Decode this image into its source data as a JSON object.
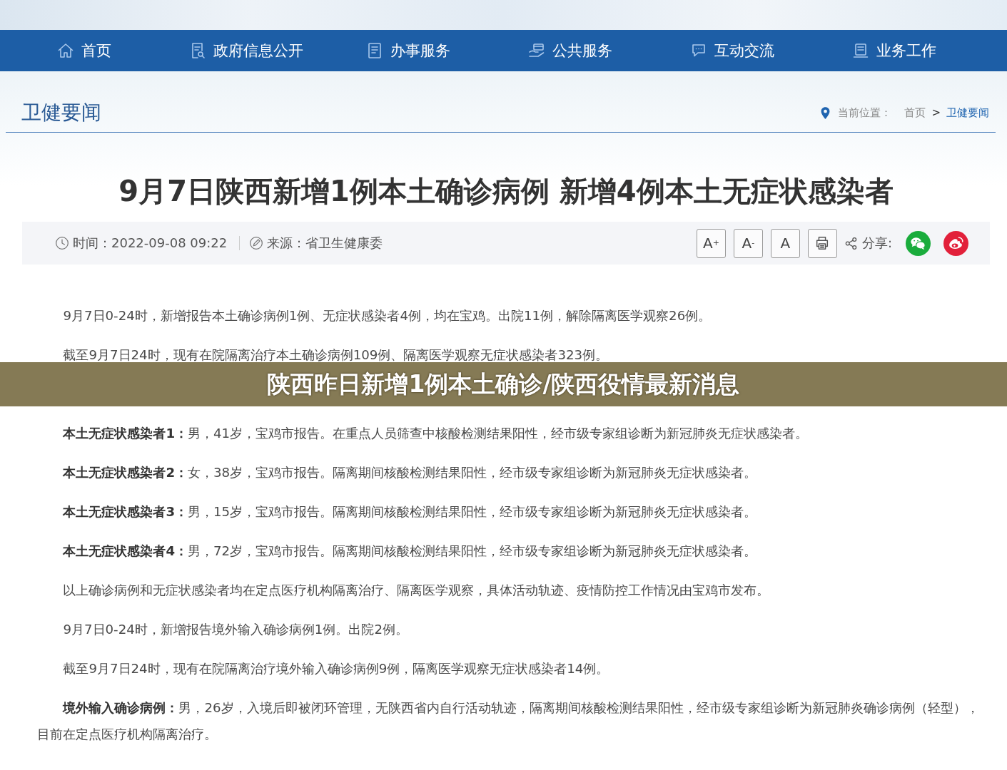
{
  "nav": [
    {
      "label": "首页",
      "selected": false
    },
    {
      "label": "政府信息公开",
      "selected": false
    },
    {
      "label": "办事服务",
      "selected": false
    },
    {
      "label": "公共服务",
      "selected": false
    },
    {
      "label": "互动交流",
      "selected": false
    },
    {
      "label": "业务工作",
      "selected": false
    }
  ],
  "section": {
    "title": "卫健要闻"
  },
  "breadcrumb": {
    "label": "当前位置：",
    "separator": ">",
    "items": [
      {
        "label": "首页",
        "current": false
      },
      {
        "label": "卫健要闻",
        "current": true
      }
    ]
  },
  "article": {
    "title": "9月7日陕西新增1例本土确诊病例 新增4例本土无症状感染者",
    "time": "时间：2022-09-08 09:22",
    "source": "来源：省卫生健康委",
    "font_buttons": [
      "A$^{+}$",
      "A$^{-}$",
      "A"
    ],
    "share_label": "分享:",
    "paragraphs": [
      "9月7日0-24时，新增报告本土确诊病例1例、无症状感染者4例，均在宝鸡。出院11例，解除隔离医学观察26例。",
      "截至9月7日24时，现有在院隔离治疗本土确诊病例109例、隔离医学观察无症状感染者323例。"
    ]
  },
  "overlay_caption": "陕西昨日新增1例本土确诊/陕西役情最新消息",
  "article_below_caption": {
    "paragraphs": [
      "**本土无症状感染者1：**男，41岁，宝鸡市报告。在重点人员筛查中核酸检测结果阳性，经市级专家组诊断为新冠肺炎无症状感染者。",
      "**本土无症状感染者2：**女，38岁，宝鸡市报告。隔离期间核酸检测结果阳性，经市级专家组诊断为新冠肺炎无症状感染者。",
      "**本土无症状感染者3：**男，15岁，宝鸡市报告。隔离期间核酸检测结果阳性，经市级专家组诊断为新冠肺炎无症状感染者。",
      "**本土无症状感染者4：**男，72岁，宝鸡市报告。隔离期间核酸检测结果阳性，经市级专家组诊断为新冠肺炎无症状感染者。",
      "以上确诊病例和无症状感染者均在定点医疗机构隔离治疗、隔离医学观察，具体活动轨迹、疫情防控工作情况由宝鸡市发布。",
      "9月7日0-24时，新增报告境外输入确诊病例1例。出院2例。",
      "截至9月7日24时，现有在院隔离治疗境外输入确诊病例9例，隔离医学观察无症状感染者14例。",
      "**境外输入确诊病例：**男，26岁，入境后即被闭环管理，无陕西省内自行活动轨迹，隔离期间核酸检测结果阳性，经市级专家组诊断为新冠肺炎确诊病例（轻型），目前在定点医疗机构隔离治疗。"
    ]
  }
}
